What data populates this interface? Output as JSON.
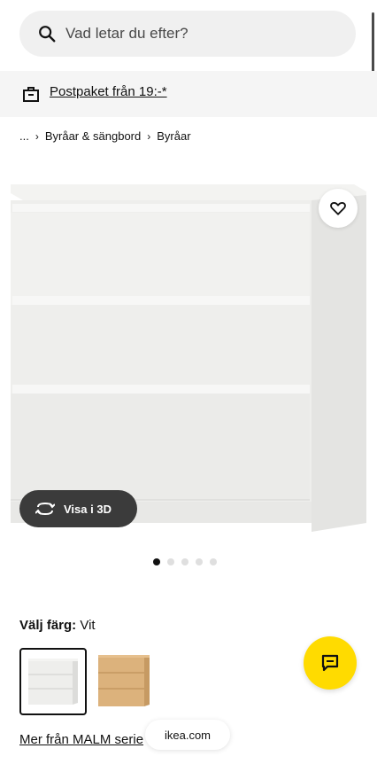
{
  "search": {
    "placeholder": "Vad letar du efter?"
  },
  "promo": {
    "text": "Postpaket från 19:-*"
  },
  "breadcrumb": {
    "ellipsis": "...",
    "items": [
      "Byråar & sängbord",
      "Byråar"
    ]
  },
  "product": {
    "view_3d_label": "Visa i 3D",
    "image_count": 5,
    "active_image_index": 0
  },
  "color": {
    "label": "Välj färg:",
    "value": "Vit"
  },
  "swatches": [
    {
      "name": "Vit",
      "selected": true
    },
    {
      "name": "Ek",
      "selected": false
    }
  ],
  "more_link": "Mer från MALM serie",
  "browser": {
    "url": "ikea.com"
  },
  "colors": {
    "accent_yellow": "#ffdb00",
    "dark_button": "#3b3b3b",
    "promo_bg": "#f5f5f5"
  }
}
